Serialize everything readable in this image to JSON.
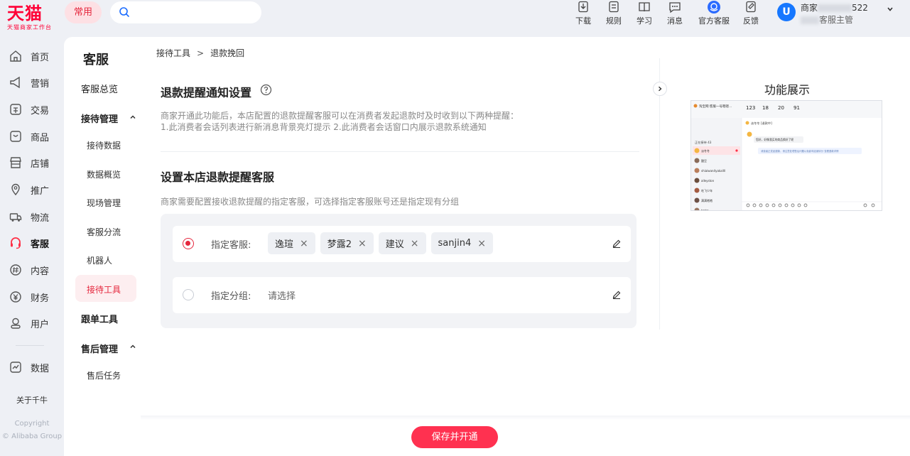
{
  "header": {
    "brand": "天猫",
    "brand_sub": "天猫商家工作台",
    "common_chip": "常用",
    "search": {
      "placeholder": ""
    },
    "icons": [
      {
        "label": "下载",
        "icon": "download-icon"
      },
      {
        "label": "规则",
        "icon": "rules-icon"
      },
      {
        "label": "学习",
        "icon": "learn-icon"
      },
      {
        "label": "消息",
        "icon": "message-icon"
      },
      {
        "label": "官方客服",
        "icon": "official-service-icon"
      },
      {
        "label": "反馈",
        "icon": "feedback-icon"
      }
    ],
    "user": {
      "name_prefix": "商家",
      "name_suffix": "522",
      "role": "客服主管"
    }
  },
  "leftnav": {
    "items": [
      {
        "label": "首页",
        "icon": "home-icon"
      },
      {
        "label": "营销",
        "icon": "marketing-icon"
      },
      {
        "label": "交易",
        "icon": "trade-icon"
      },
      {
        "label": "商品",
        "icon": "goods-icon"
      },
      {
        "label": "店铺",
        "icon": "store-icon"
      },
      {
        "label": "推广",
        "icon": "promotion-icon"
      },
      {
        "label": "物流",
        "icon": "logistics-icon"
      },
      {
        "label": "客服",
        "icon": "headset-icon",
        "active": true
      },
      {
        "label": "内容",
        "icon": "content-icon"
      },
      {
        "label": "财务",
        "icon": "finance-icon"
      },
      {
        "label": "用户",
        "icon": "user-icon"
      },
      {
        "label": "数据",
        "icon": "data-icon"
      }
    ],
    "about": "关于千牛",
    "copyright_1": "Copyright",
    "copyright_2": "© Alibaba Group"
  },
  "subnav": {
    "title": "客服",
    "overview": "客服总览",
    "reception_group": "接待管理",
    "reception_items": [
      "接待数据",
      "数据概览",
      "现场管理",
      "客服分流",
      "机器人",
      "接待工具"
    ],
    "active_item": "接待工具",
    "order_tools": "跟单工具",
    "aftersale_group": "售后管理",
    "aftersale_items": [
      "售后任务"
    ]
  },
  "breadcrumb": {
    "parent": "接待工具",
    "separator": ">",
    "current": "退款挽回"
  },
  "section1": {
    "title": "退款提醒通知设置",
    "desc_line1": "商家开通此功能后，本店配置的退款提醒客服可以在消费者发起退款时及时收到以下两种提醒：",
    "desc_line2": "1.此消费者会话列表进行新消息背景亮灯提示 2.此消费者会话窗口内展示退款系统通知"
  },
  "section2": {
    "title": "设置本店退款提醒客服",
    "desc": "商家需要配置接收退款提醒的指定客服，可选择指定客服账号还是指定现有分组",
    "option_service": {
      "label": "指定客服:",
      "selected": true,
      "tags": [
        "逸瑄",
        "梦露2",
        "建议",
        "sanjin4"
      ]
    },
    "option_group": {
      "label": "指定分组:",
      "selected": false,
      "placeholder": "请选择"
    }
  },
  "preview": {
    "title": "功能展示",
    "shop_name": "淘宝网:客服一号嗯嗯...",
    "stats": [
      "123",
      "18",
      "20",
      "91"
    ],
    "list_header": "正在接待 43",
    "contacts": [
      "淡冬冬",
      "酸豆",
      "shiaiwan4yakallll",
      "alleyston",
      "吃飞少年",
      "满满嗒嗒",
      "tmtm"
    ],
    "chat_name": "淡冬冬 [退款中]",
    "msg": "您好，好像我买的商品换好了呢",
    "notice": "消费者正发起退款，请注意处理售后问题以免影响店铺评分 查看退款详情"
  },
  "footer": {
    "save_button": "保存并开通"
  }
}
